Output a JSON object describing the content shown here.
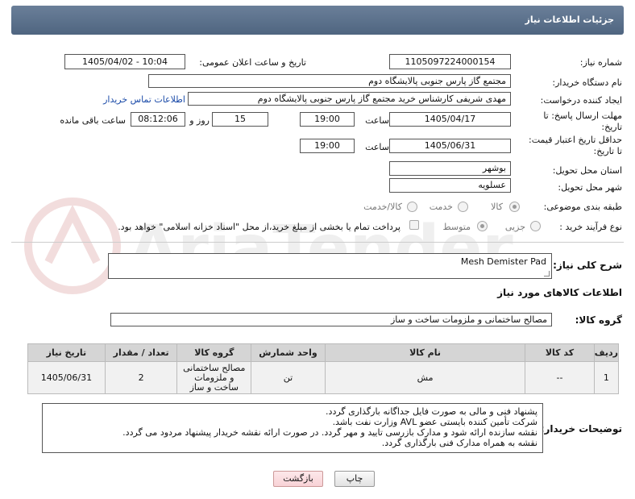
{
  "header": {
    "title": "جزئیات اطلاعات نیاز"
  },
  "form": {
    "need_number_label": "شماره نیاز:",
    "need_number": "1105097224000154",
    "announce_label": "تاریخ و ساعت اعلان عمومی:",
    "announce_value": "1405/04/02 - 10:04",
    "buyer_org_label": "نام دستگاه خریدار:",
    "buyer_org": "مجتمع گاز پارس جنوبی  پالایشگاه دوم",
    "creator_label": "ایجاد کننده درخواست:",
    "creator": "مهدی شریفی کارشناس خرید مجتمع گاز پارس جنوبی  پالایشگاه دوم",
    "contact_link": "اطلاعات تماس خریدار",
    "deadline_label_1": "مهلت ارسال پاسخ: تا",
    "deadline_label_2": "تاریخ:",
    "deadline_date": "1405/04/17",
    "time_label": "ساعت",
    "deadline_time": "19:00",
    "days_value": "15",
    "days_label": "روز و",
    "remaining_time": "08:12:06",
    "remaining_label": "ساعت باقی مانده",
    "validity_label_1": "حداقل تاریخ اعتبار قیمت:",
    "validity_label_2": "تا تاریخ:",
    "validity_date": "1405/06/31",
    "validity_time": "19:00",
    "province_label": "استان محل تحویل:",
    "province": "بوشهر",
    "city_label": "شهر محل تحویل:",
    "city": "عسلویه",
    "category_label": "طبقه بندی موضوعی:",
    "category_options": [
      "کالا",
      "خدمت",
      "کالا/خدمت"
    ],
    "category_selected": "کالا",
    "process_label": "نوع فرآیند خرید :",
    "process_options": [
      "جزیی",
      "متوسط"
    ],
    "process_selected": "متوسط",
    "payment_note": "پرداخت تمام یا بخشی از مبلغ خرید،از محل \"اسناد خزانه اسلامی\" خواهد بود."
  },
  "description": {
    "label": "شرح کلی نیاز:",
    "value": "Mesh Demister Pad"
  },
  "goods_info": {
    "title": "اطلاعات کالاهای مورد نیاز",
    "group_label": "گروه کالا:",
    "group_value": "مصالح ساختمانی و ملزومات ساخت و ساز"
  },
  "table": {
    "headers": [
      "ردیف",
      "کد کالا",
      "نام کالا",
      "واحد شمارش",
      "گروه کالا",
      "تعداد / مقدار",
      "تاریخ نیاز"
    ],
    "rows": [
      [
        "1",
        "--",
        "مش",
        "تن",
        "مصالح ساختمانی و ملزومات ساخت و ساز",
        "2",
        "1405/06/31"
      ]
    ]
  },
  "buyer_notes": {
    "label": "توضیحات خریدار:",
    "lines": [
      "پشنهاد فنی و مالی به صورت فایل جداگانه بارگذاری گردد.",
      "شرکت تأمین کننده بایستی عضو AVL وزارت نفت باشد.",
      "نقشه سازنده ارائه شود و مدارک بازرسی تایید و مهر گردد. در صورت ارائه نقشه خریدار پیشنهاد مردود می گردد.",
      "نقشه به همراه مدارک فنی بارگذاری گردد."
    ]
  },
  "buttons": {
    "print": "چاپ",
    "back": "بازگشت"
  },
  "watermark": {
    "text": "AriaTender.net"
  }
}
